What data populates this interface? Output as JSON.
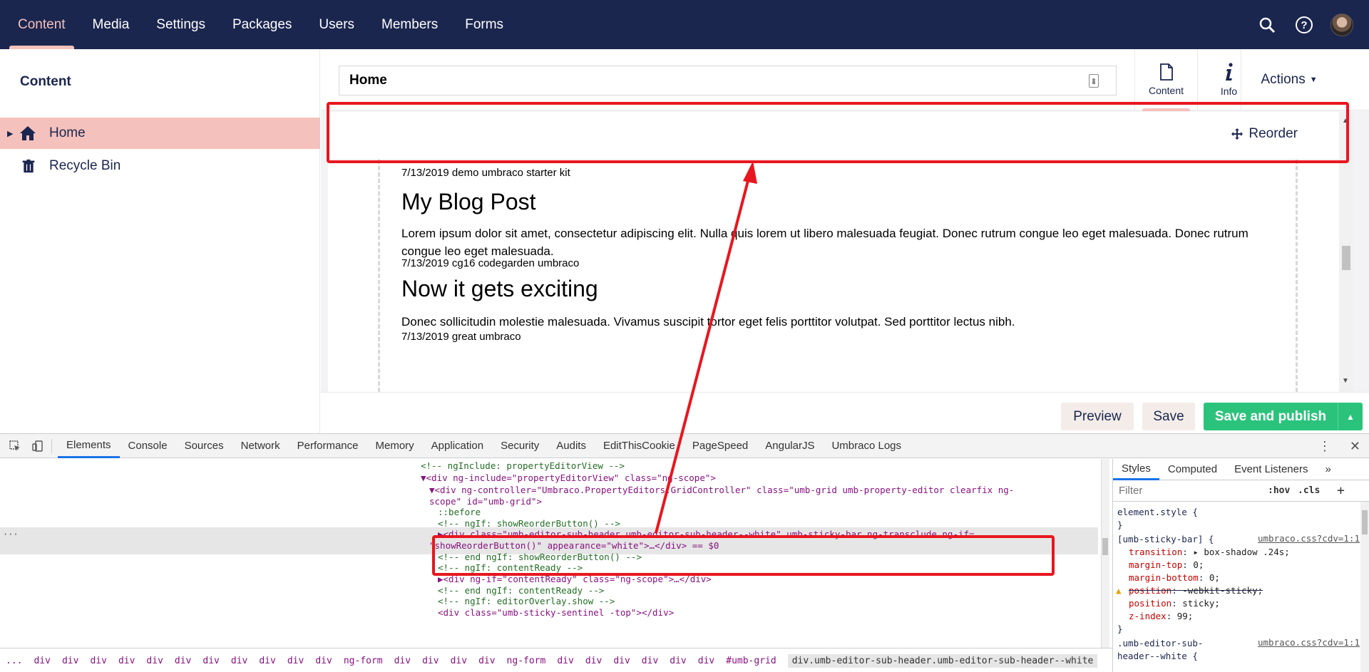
{
  "nav": {
    "items": [
      "Content",
      "Media",
      "Settings",
      "Packages",
      "Users",
      "Members",
      "Forms"
    ],
    "active": "Content",
    "search_icon": "search-icon",
    "help_icon": "help-icon"
  },
  "tree": {
    "title": "Content",
    "items": [
      {
        "label": "Home",
        "icon": "home-icon",
        "selected": true
      },
      {
        "label": "Recycle Bin",
        "icon": "trash-icon",
        "selected": false
      }
    ]
  },
  "editor": {
    "name_value": "Home",
    "apps": [
      {
        "label": "Content",
        "icon": "document-icon",
        "active": true
      },
      {
        "label": "Info",
        "icon": "info-icon",
        "active": false
      }
    ],
    "actions_label": "Actions",
    "reorder_label": "Reorder",
    "posts": [
      {
        "meta_top": "7/13/2019 demo umbraco starter kit"
      },
      {
        "title": "My Blog Post",
        "body": "Lorem ipsum dolor sit amet, consectetur adipiscing elit. Nulla quis lorem ut libero malesuada feugiat. Donec rutrum congue leo eget malesuada. Donec rutrum congue leo eget malesuada.",
        "meta": "7/13/2019 cg16 codegarden umbraco"
      },
      {
        "title": "Now it gets exciting",
        "body": "Donec sollicitudin molestie malesuada. Vivamus suscipit tortor eget felis porttitor volutpat. Sed porttitor lectus nibh.",
        "meta": "7/13/2019 great umbraco"
      }
    ],
    "buttons": {
      "preview": "Preview",
      "save": "Save",
      "publish": "Save and publish"
    }
  },
  "devtools": {
    "tabs": [
      "Elements",
      "Console",
      "Sources",
      "Network",
      "Performance",
      "Memory",
      "Application",
      "Security",
      "Audits",
      "EditThisCookie",
      "PageSpeed",
      "AngularJS",
      "Umbraco Logs"
    ],
    "active_tab": "Elements",
    "dom_lines": [
      {
        "indent": 0,
        "html": "<!-- ngInclude: propertyEditorView -->"
      },
      {
        "indent": 0,
        "html": "▼<div ng-include=\"propertyEditorView\" class=\"ng-scope\">"
      },
      {
        "indent": 1,
        "html": "▼<div ng-controller=\"Umbraco.PropertyEditors.GridController\" class=\"umb-grid umb-property-editor clearfix ng-"
      },
      {
        "indent": 1,
        "html": "scope\" id=\"umb-grid\">"
      },
      {
        "indent": 2,
        "html": "::before"
      },
      {
        "indent": 2,
        "html": "<!-- ngIf: showReorderButton() -->"
      },
      {
        "indent": 2,
        "html": "▶<div class=\"umb-editor-sub-header umb-editor-sub-header--white\" umb-sticky-bar ng-transclude ng-if="
      },
      {
        "indent": 1,
        "html": "\"showReorderButton()\" appearance=\"white\">…</div> == $0"
      },
      {
        "indent": 2,
        "html": "<!-- end ngIf: showReorderButton() -->"
      },
      {
        "indent": 2,
        "html": "<!-- ngIf: contentReady -->"
      },
      {
        "indent": 2,
        "html": "▶<div ng-if=\"contentReady\" class=\"ng-scope\">…</div>"
      },
      {
        "indent": 2,
        "html": "<!-- end ngIf: contentReady -->"
      },
      {
        "indent": 2,
        "html": "<!-- ngIf: editorOverlay.show -->"
      },
      {
        "indent": 2,
        "html": "<div class=\"umb-sticky-sentinel -top\"></div>"
      }
    ],
    "breadcrumbs": [
      "...",
      "div",
      "div",
      "div",
      "div",
      "div",
      "div",
      "div",
      "div",
      "div",
      "div",
      "div",
      "ng-form",
      "div",
      "div",
      "div",
      "div",
      "ng-form",
      "div",
      "div",
      "div",
      "div",
      "div",
      "div",
      "#umb-grid",
      "div.umb-editor-sub-header.umb-editor-sub-header--white"
    ],
    "styles": {
      "tabs": [
        "Styles",
        "Computed",
        "Event Listeners",
        "»"
      ],
      "filter_placeholder": "Filter",
      "hov": ":hov",
      "cls": ".cls",
      "element_style": "element.style {",
      "close_brace": "}",
      "rule_selector": "[umb-sticky-bar] {",
      "rule_source": "umbraco.css?cdv=1:1",
      "props": [
        {
          "name": "transition",
          "value": "▸ box-shadow .24s;",
          "struck": false,
          "warn": false
        },
        {
          "name": "margin-top",
          "value": "0;",
          "struck": false,
          "warn": false
        },
        {
          "name": "margin-bottom",
          "value": "0;",
          "struck": false,
          "warn": false
        },
        {
          "name": "position",
          "value": "-webkit-sticky;",
          "struck": true,
          "warn": true
        },
        {
          "name": "position",
          "value": "sticky;",
          "struck": false,
          "warn": false
        },
        {
          "name": "z-index",
          "value": "99;",
          "struck": false,
          "warn": false
        }
      ],
      "next_selector": ".umb-editor-sub-",
      "next_selector_2": "header--white {",
      "next_source": "umbraco.css?cdv=1:1"
    }
  },
  "colors": {
    "nav_bg": "#1b264f",
    "accent": "#f5c1bc",
    "publish": "#2bc37c",
    "highlight": "#e8161f"
  }
}
